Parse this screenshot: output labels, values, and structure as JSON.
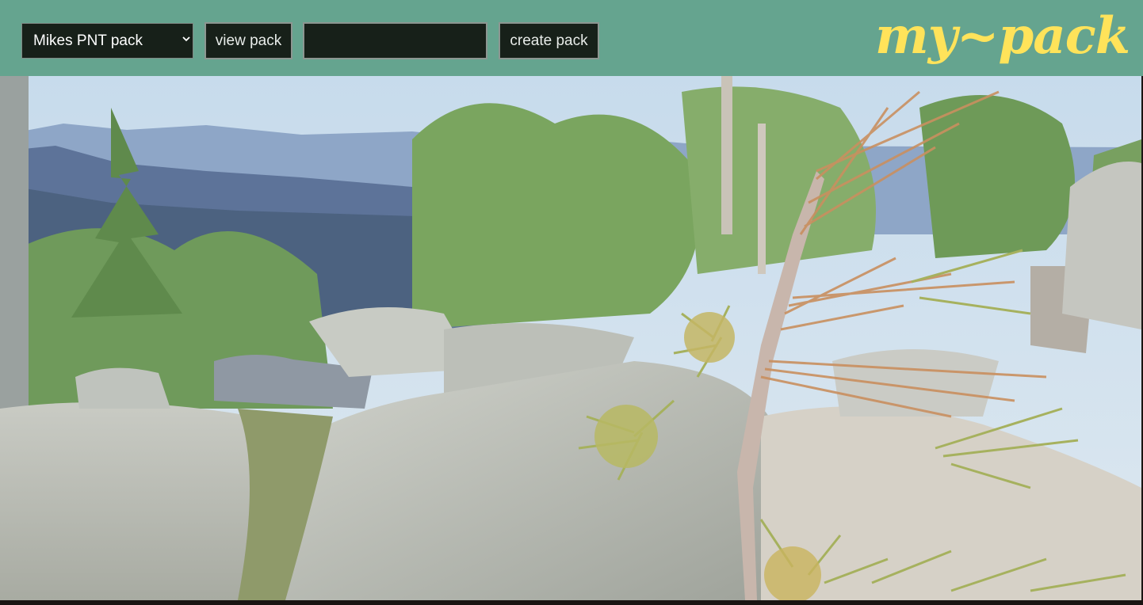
{
  "header": {
    "pack_select": {
      "selected": "Mikes PNT pack",
      "options": [
        "Mikes PNT pack"
      ]
    },
    "view_button_label": "view pack",
    "pack_name_input": {
      "value": "",
      "placeholder": ""
    },
    "create_button_label": "create pack",
    "logo_text": "my~pack"
  },
  "icons": {
    "select_arrow": "chevron-down-icon"
  },
  "colors": {
    "header_bg": "#65a48f",
    "control_bg": "#172019",
    "logo": "#ffe35a"
  }
}
